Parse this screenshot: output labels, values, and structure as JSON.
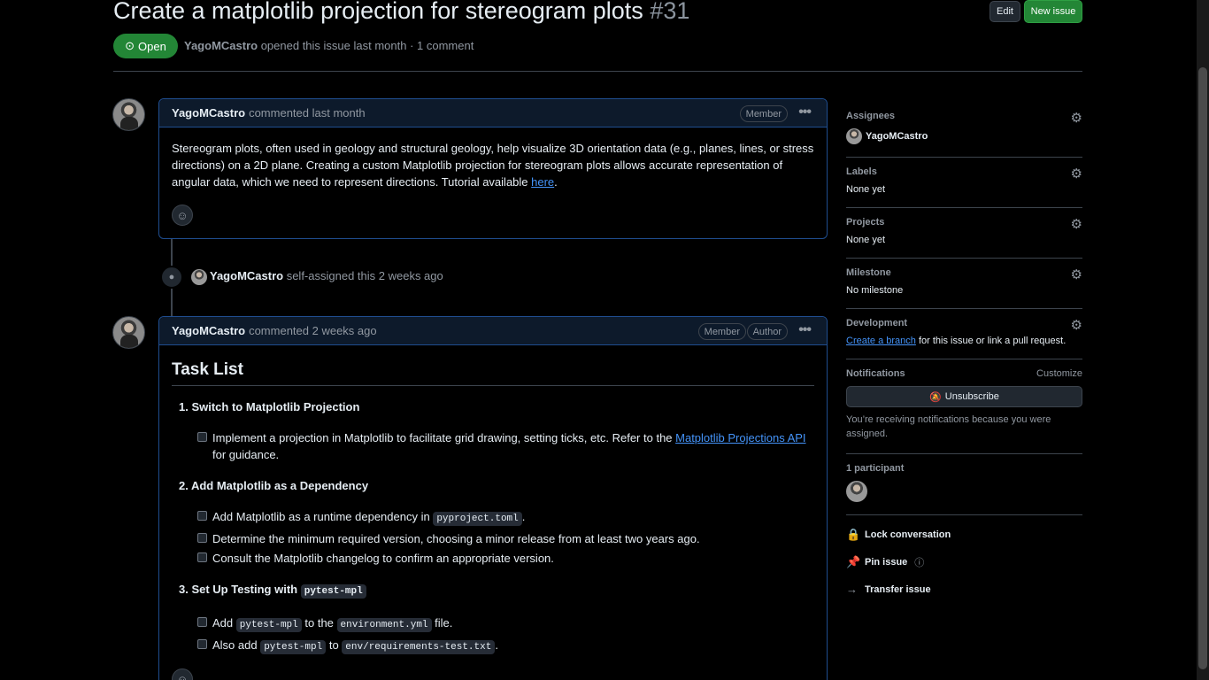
{
  "issue": {
    "title": "Create a matplotlib projection for stereogram plots",
    "number": "#31",
    "state": "Open",
    "author": "YagoMCastro",
    "meta_text": "opened this issue last month · 1 comment"
  },
  "header_buttons": {
    "edit": "Edit",
    "new_issue": "New issue"
  },
  "comment1": {
    "author": "YagoMCastro",
    "when": "commented last month",
    "badge": "Member",
    "body": "Stereogram plots, often used in geology and structural geology, help visualize 3D orientation data (e.g., planes, lines, or stress directions) on a 2D plane. Creating a custom Matplotlib projection for stereogram plots allows accurate representation of angular data, which we need to represent directions. Tutorial available ",
    "link": "here",
    "body_end": "."
  },
  "event": {
    "author": "YagoMCastro",
    "text": "self-assigned this 2 weeks ago"
  },
  "comment2": {
    "author": "YagoMCastro",
    "when": "commented 2 weeks ago",
    "badge_member": "Member",
    "badge_author": "Author",
    "heading": "Task List",
    "sections": [
      {
        "title": "1. Switch to Matplotlib Projection",
        "t1_pre": "Implement a projection in Matplotlib to facilitate grid drawing, setting ticks, etc. Refer to the ",
        "t1_link": "Matplotlib Projections API",
        "t1_post": " for guidance."
      },
      {
        "title": "2. Add Matplotlib as a Dependency",
        "t1_pre": "Add Matplotlib as a runtime dependency in ",
        "t1_code": "pyproject.toml",
        "t1_post": ".",
        "t2": "Determine the minimum required version, choosing a minor release from at least two years ago.",
        "t3": "Consult the Matplotlib changelog to confirm an appropriate version."
      },
      {
        "title_pre": "3. Set Up Testing with ",
        "title_code": "pytest-mpl",
        "t1_a": "Add ",
        "t1_code1": "pytest-mpl",
        "t1_b": " to the ",
        "t1_code2": "environment.yml",
        "t1_c": " file.",
        "t2_a": "Also add ",
        "t2_code1": "pytest-mpl",
        "t2_b": " to ",
        "t2_code2": "env/requirements-test.txt",
        "t2_c": "."
      }
    ]
  },
  "sidebar": {
    "assignees_title": "Assignees",
    "assignee": "YagoMCastro",
    "labels_title": "Labels",
    "labels_value": "None yet",
    "projects_title": "Projects",
    "projects_value": "None yet",
    "milestone_title": "Milestone",
    "milestone_value": "No milestone",
    "development_title": "Development",
    "dev_link": "Create a branch",
    "dev_text": " for this issue or link a pull request.",
    "notifications_title": "Notifications",
    "customize": "Customize",
    "unsubscribe": "Unsubscribe",
    "notif_text": "You’re receiving notifications because you were assigned.",
    "participants_title": "1 participant",
    "lock": "Lock conversation",
    "pin": "Pin issue",
    "transfer": "Transfer issue"
  },
  "colors": {
    "accent": "#4493f8",
    "success": "#238636",
    "border": "#3d444d",
    "muted": "#9198a1"
  }
}
